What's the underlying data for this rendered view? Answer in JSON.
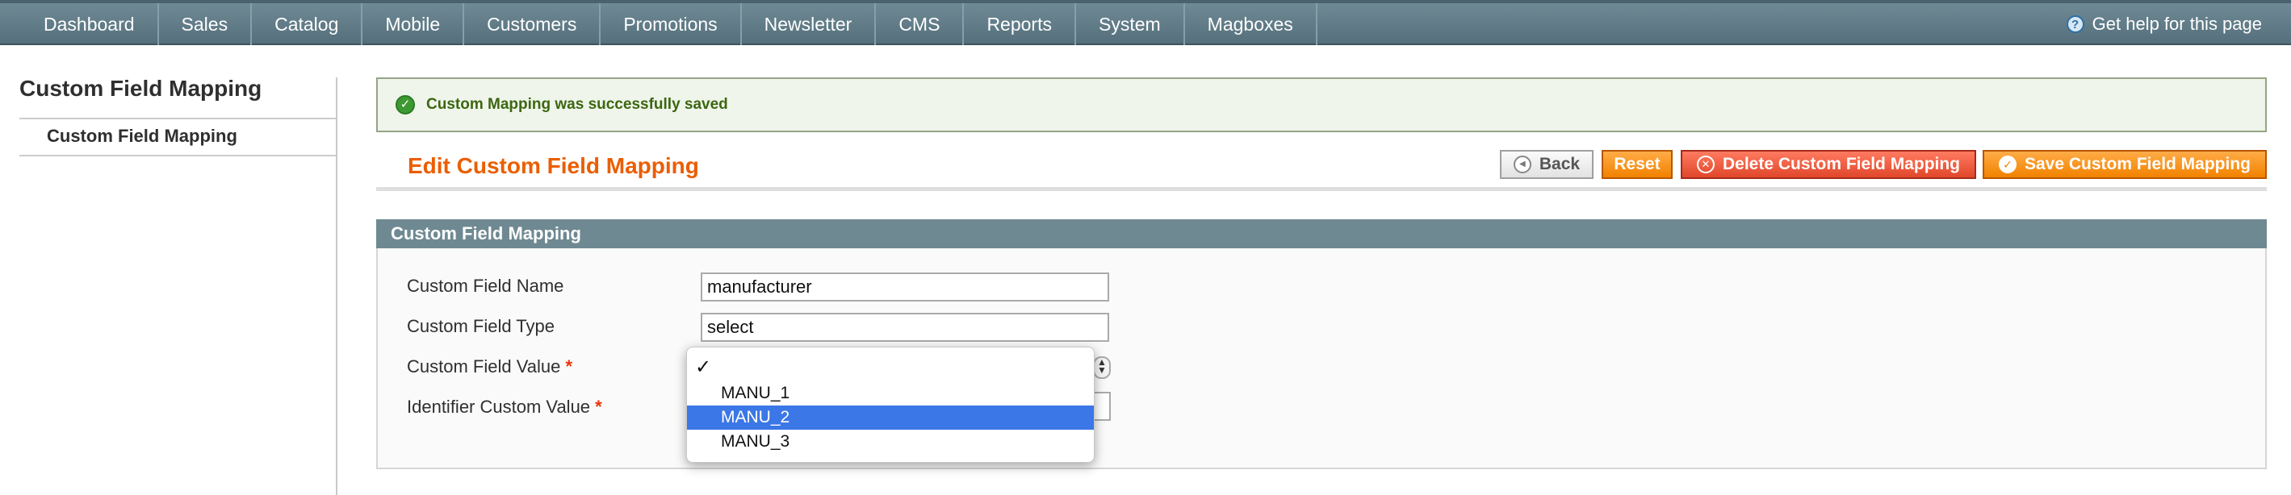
{
  "nav": {
    "items": [
      "Dashboard",
      "Sales",
      "Catalog",
      "Mobile",
      "Customers",
      "Promotions",
      "Newsletter",
      "CMS",
      "Reports",
      "System",
      "Magboxes"
    ],
    "help_label": "Get help for this page",
    "help_icon": "help-icon"
  },
  "sidebar": {
    "title": "Custom Field Mapping",
    "items": [
      {
        "label": "Custom Field Mapping"
      }
    ]
  },
  "message": {
    "text": "Custom Mapping was successfully saved",
    "icon": "success-check-icon"
  },
  "page": {
    "title": "Edit Custom Field Mapping",
    "buttons": {
      "back": "Back",
      "reset": "Reset",
      "delete": "Delete Custom Field Mapping",
      "save": "Save Custom Field Mapping"
    }
  },
  "fieldset": {
    "title": "Custom Field Mapping",
    "fields": {
      "name_label": "Custom Field Name",
      "name_value": "manufacturer",
      "type_label": "Custom Field Type",
      "type_value": "select",
      "value_label": "Custom Field Value",
      "identifier_label": "Identifier Custom Value",
      "required_mark": "*"
    }
  },
  "dropdown": {
    "check": "✓",
    "options": [
      "MANU_1",
      "MANU_2",
      "MANU_3"
    ],
    "selected": "MANU_2"
  },
  "colors": {
    "nav_bg": "#5f7b86",
    "accent_orange": "#eb5e00",
    "button_orange": "#f18200",
    "button_red": "#e0472a",
    "success_green": "#3d6611",
    "fieldset_header": "#6f8992",
    "selection_blue": "#3b77e6"
  }
}
